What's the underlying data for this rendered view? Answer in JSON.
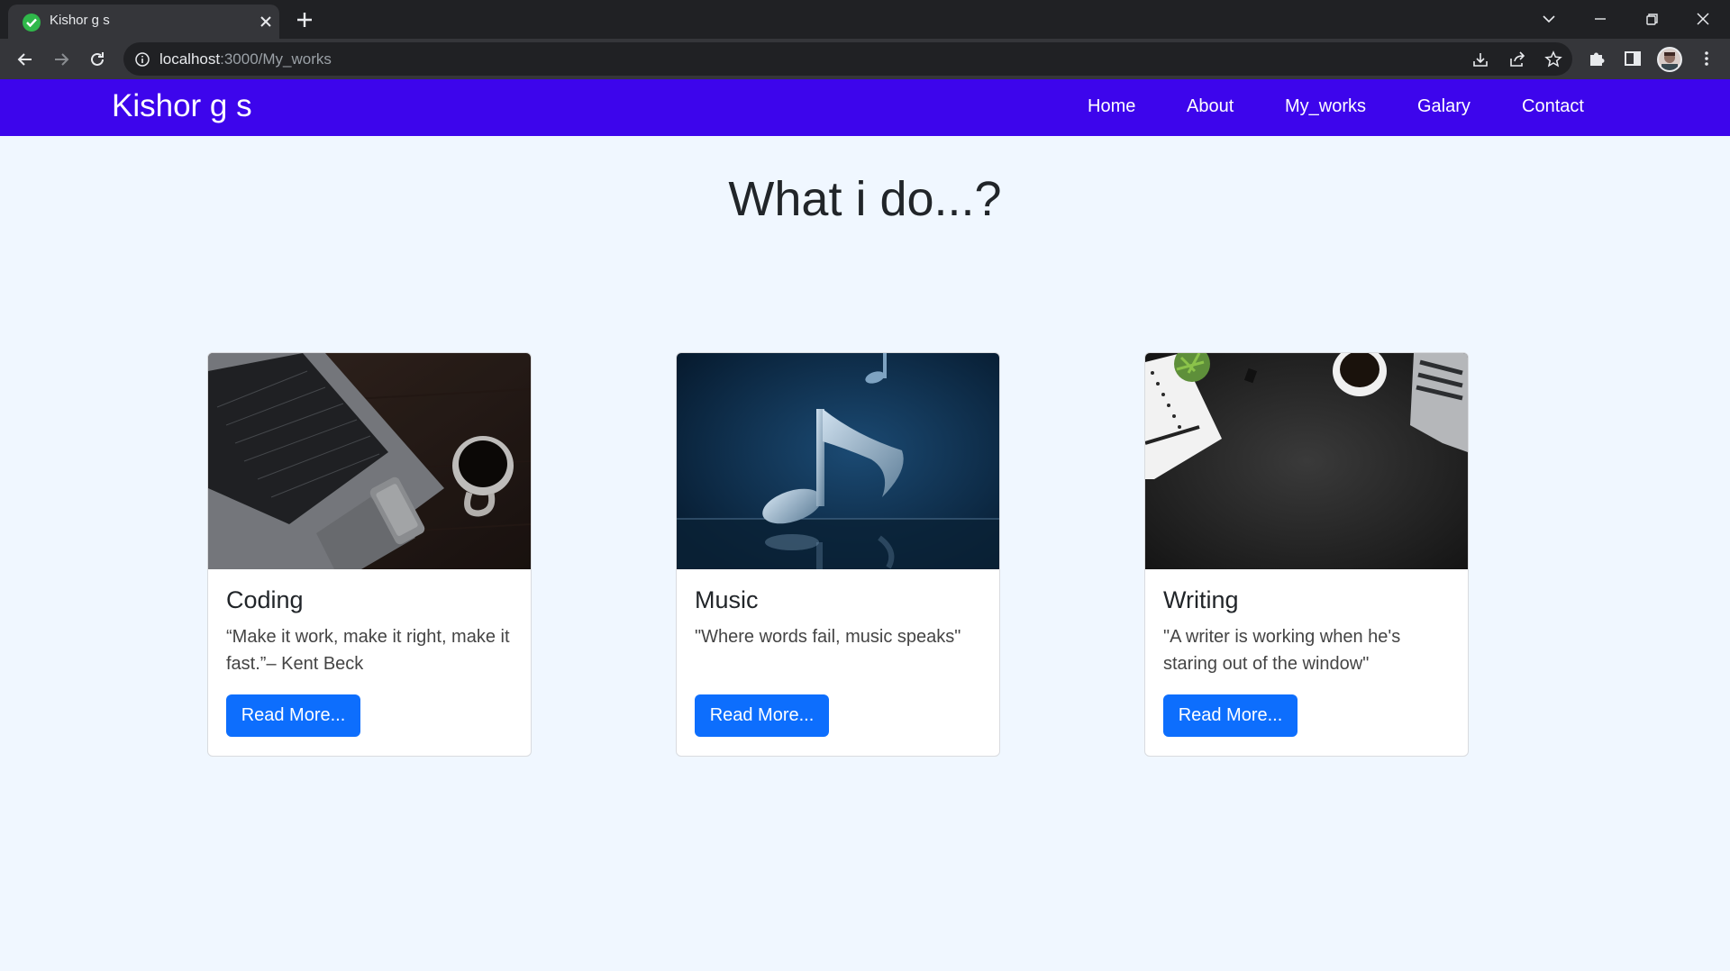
{
  "browser": {
    "tab_title": "Kishor g s",
    "url_host": "localhost",
    "url_path": ":3000/My_works"
  },
  "site": {
    "brand": "Kishor g s",
    "nav": [
      "Home",
      "About",
      "My_works",
      "Galary",
      "Contact"
    ],
    "accent_color": "#3d05ec",
    "button_color": "#0d6efd"
  },
  "main": {
    "heading": "What i do...?",
    "cards": [
      {
        "title": "Coding",
        "text": "“Make it work, make it right, make it fast.”– Kent Beck",
        "button": "Read More..."
      },
      {
        "title": "Music",
        "text": "\"Where words fail, music speaks\"",
        "button": "Read More..."
      },
      {
        "title": "Writing",
        "text": "\"A writer is working when he's staring out of the window\"",
        "button": "Read More..."
      }
    ]
  }
}
